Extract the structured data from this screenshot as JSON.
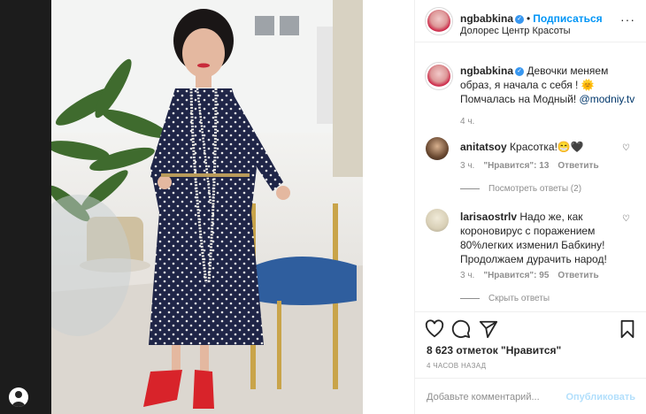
{
  "header": {
    "username": "ngbabkina",
    "follow_label": "Подписаться",
    "location": "Долорес Центр Красоты",
    "more_icon": "more-options-icon"
  },
  "caption": {
    "username": "ngbabkina",
    "text_before_link": "Девочки меняем образ, я начала с себя ! 🌞 Помчалась на Модный! ",
    "link": "@modniy.tv",
    "time": "4 ч."
  },
  "comments": [
    {
      "username": "anitatsoy",
      "text": "Красотка!😁🖤",
      "time": "3 ч.",
      "likes": "\"Нравится\": 13",
      "reply_label": "Ответить",
      "view_replies": "Посмотреть ответы (2)"
    },
    {
      "username": "larisaostrlv",
      "text": "Надо же, как короновирус с поражением 80%легких изменил Бабкину! Продолжаем дурачить народ!",
      "time": "3 ч.",
      "likes": "\"Нравится\": 95",
      "reply_label": "Ответить",
      "hide_replies": "Скрыть ответы"
    }
  ],
  "actions": {
    "like_icon": "heart-icon",
    "comment_icon": "comment-icon",
    "share_icon": "share-icon",
    "save_icon": "bookmark-icon",
    "likes_text": "8 623 отметок \"Нравится\"",
    "posted_ago": "4 ЧАСОВ НАЗАД"
  },
  "add_comment": {
    "placeholder": "Добавьте комментарий...",
    "publish_label": "Опубликовать"
  },
  "colors": {
    "accent": "#0095f6",
    "verified": "#3897f0",
    "muted": "#8e8e8e",
    "publish_disabled": "#b2dffc"
  }
}
